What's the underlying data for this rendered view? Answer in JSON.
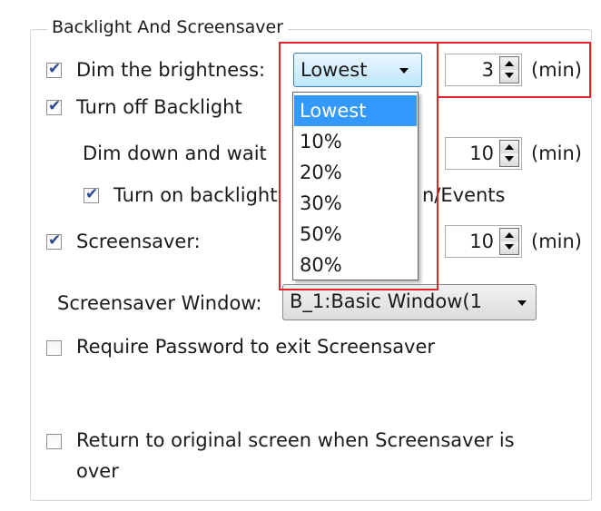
{
  "group": {
    "title": "Backlight And Screensaver"
  },
  "dim_brightness": {
    "label": "Dim the brightness:",
    "checked": true,
    "combo_value": "Lowest",
    "minutes": "3",
    "unit": "(min)"
  },
  "turn_off_backlight": {
    "label": "Turn off Backlight",
    "checked": true
  },
  "dim_down_wait": {
    "label": "Dim down and wait",
    "obscured_suffix": "t",
    "minutes": "10",
    "unit": "(min)"
  },
  "turn_on_backlight": {
    "label": "Turn on backlight",
    "obscured_suffix": "n/Events",
    "checked": true
  },
  "screensaver": {
    "label": "Screensaver:",
    "checked": true,
    "minutes": "10",
    "unit": "(min)"
  },
  "screensaver_window": {
    "label": "Screensaver Window:",
    "value": "B_1:Basic Window(1"
  },
  "require_password": {
    "label": "Require Password to exit Screensaver",
    "checked": false
  },
  "return_original": {
    "label_line1": "Return to original screen when Screensaver is",
    "label_line2": "over",
    "checked": false
  },
  "dropdown": {
    "options": [
      "Lowest",
      "10%",
      "20%",
      "30%",
      "50%",
      "80%"
    ],
    "selected_index": 0
  },
  "colors": {
    "highlight_frame": "#e8222a",
    "selection": "#3399ff"
  }
}
